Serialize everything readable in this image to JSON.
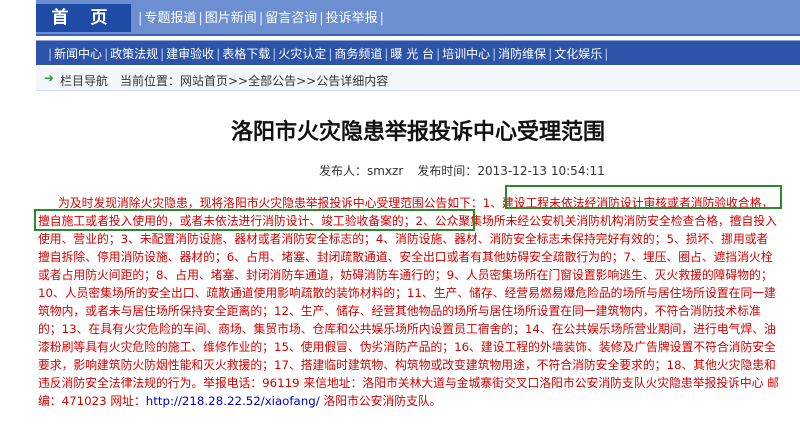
{
  "topnav": {
    "home": "首 页",
    "links": [
      "专题报道",
      "图片新闻",
      "留言咨询",
      "投诉举报"
    ]
  },
  "subnav": {
    "items": [
      "新闻中心",
      "政策法规",
      "建审验收",
      "表格下载",
      "火灾认定",
      "商务频道",
      "曝 光 台",
      "培训中心",
      "消防维保",
      "文化娱乐"
    ]
  },
  "breadcrumb": {
    "nav_label": "栏目导航",
    "location": "当前位置：网站首页>>全部公告>>公告详细内容"
  },
  "article": {
    "title": "洛阳市火灾隐患举报投诉中心受理范围",
    "meta": {
      "publisher_label": "发布人：",
      "publisher": "smxzr",
      "time_label": "发布时间：",
      "time": "2013-12-13 10:54:11"
    },
    "body_text": "为及时发现消除火灾隐患，现将洛阳市火灾隐患举报投诉中心受理范围公告如下：1、建设工程未依法经消防设计审核或者消防验收合格，擅自施工或者投入使用的，或者未依法进行消防设计、竣工验收备案的；2、公众聚集场所未经公安机关消防机构消防安全检查合格，擅自投入使用、营业的；3、未配置消防设施、器材或者消防安全标志的；4、消防设施、器材、消防安全标志未保持完好有效的；5、损坏、挪用或者擅自拆除、停用消防设施、器材的；6、占用、堵塞、封闭疏散通道、安全出口或者有其他妨碍安全疏散行为的；7、埋压、圈占、遮挡消火栓或者占用防火间距的；8、占用、堵塞、封闭消防车通道，妨碍消防车通行的；9、人员密集场所在门窗设置影响逃生、灭火救援的障碍物的；10、人员密集场所的安全出口、疏散通道使用影响疏散的装饰材料的；11、生产、储存、经营易燃易爆危险品的场所与居住场所设置在同一建筑物内，或者未与居住场所保持安全距离的；12、生产、储存、经营其他物品的场所与居住场所设置在同一建筑物内，不符合消防技术标准的；13、在具有火灾危险的车间、商场、集贸市场、仓库和公共娱乐场所内设置员工宿舍的；14、在公共娱乐场所营业期间，进行电气焊、油漆粉刷等具有火灾危险的施工、维修作业的；15、使用假冒、伪劣消防产品的；16、建设工程的外墙装饰、装修及广告牌设置不符合消防安全要求，影响建筑防火防烟性能和灭火救援的；17、搭建临时建筑物、构筑物或改变建筑物用途，不符合消防安全要求的；18、其他火灾隐患和违反消防安全法律法规的行为。举报电话：96119 来信地址：洛阳市关林大道与金城寨街交叉口洛阳市公安消防支队火灾隐患举报投诉中心 邮编：471023 网址：",
    "link_text": "http://218.28.22.52/xiaofang/",
    "body_end": " 洛阳市公安消防支队。"
  },
  "colors": {
    "nav_blue": "#2d54a8",
    "body_red": "#d40000",
    "highlight_green": "#2c8a2c"
  }
}
